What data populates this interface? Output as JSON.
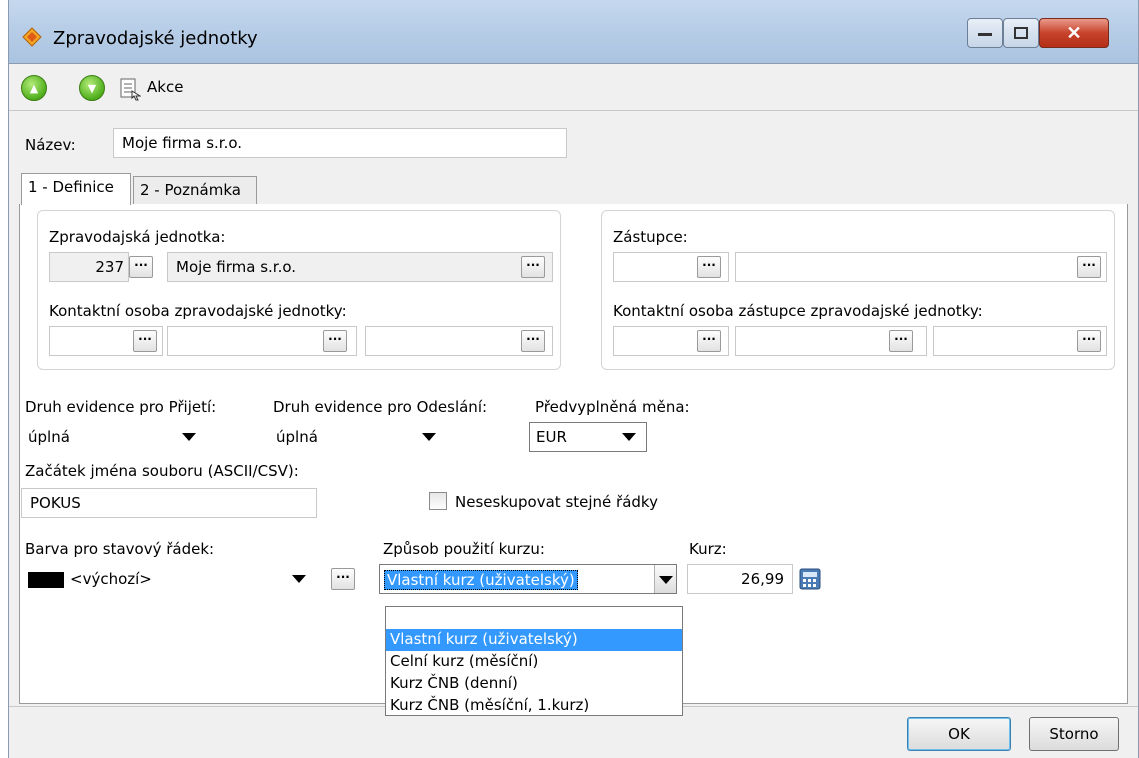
{
  "window": {
    "title": "Zpravodajské jednotky"
  },
  "toolbar": {
    "up_icon": "arrow-up-circle-icon",
    "down_icon": "arrow-down-circle-icon",
    "akce_label": "Akce"
  },
  "header": {
    "name_label": "Název:",
    "name_value": "Moje firma s.r.o."
  },
  "tabs": [
    {
      "label": "1 - Definice",
      "active": true
    },
    {
      "label": "2 - Poznámka",
      "active": false
    }
  ],
  "left_group": {
    "unit_label": "Zpravodajská jednotka:",
    "unit_number": "237",
    "unit_name": "Moje firma s.r.o.",
    "contact_label": "Kontaktní osoba zpravodajské jednotky:"
  },
  "right_group": {
    "deputy_label": "Zástupce:",
    "contact_label": "Kontaktní osoba zástupce zpravodajské jednotky:"
  },
  "form": {
    "receive_label": "Druh evidence pro Přijetí:",
    "receive_value": "úplná",
    "send_label": "Druh evidence pro Odeslání:",
    "send_value": "úplná",
    "currency_label": "Předvyplněná měna:",
    "currency_value": "EUR",
    "file_prefix_label": "Začátek jména souboru (ASCII/CSV):",
    "file_prefix_value": "POKUS",
    "no_group_label": "Neseskupovat stejné řádky",
    "status_color_label": "Barva pro stavový řádek:",
    "status_color_value": "<výchozí>",
    "rate_method_label": "Způsob použití kurzu:",
    "rate_method_value": "Vlastní kurz (uživatelský)",
    "rate_label": "Kurz:",
    "rate_value": "26,99",
    "rate_options": [
      "",
      "Vlastní kurz (uživatelský)",
      "Celní kurz (měsíční)",
      "Kurz ČNB (denní)",
      "Kurz ČNB (měsíční, 1.kurz)"
    ]
  },
  "buttons": {
    "ok": "OK",
    "cancel": "Storno"
  },
  "colors": {
    "selection": "#3399ff",
    "status_swatch": "#000000"
  }
}
